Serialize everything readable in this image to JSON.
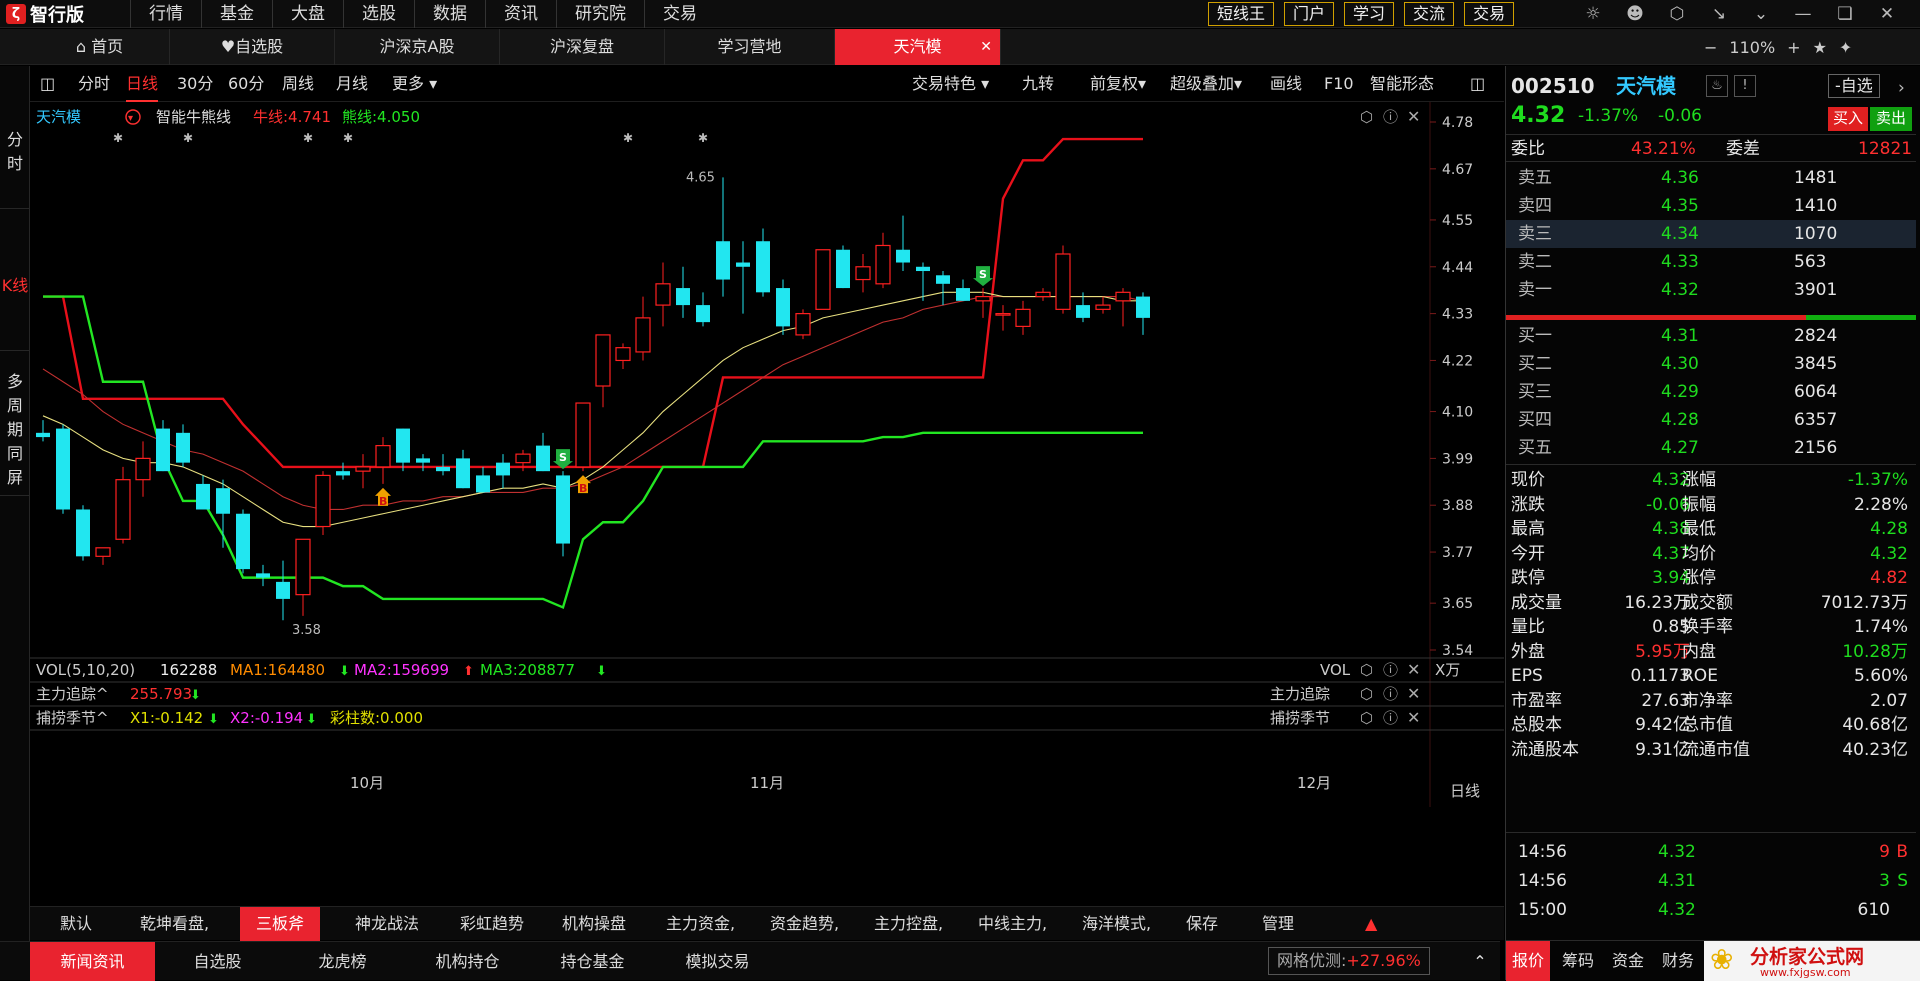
{
  "app": {
    "name": "智行版",
    "logo_glyph": "ζ"
  },
  "top_menu": [
    "行情",
    "基金",
    "大盘",
    "选股",
    "数据",
    "资讯",
    "研究院",
    "交易"
  ],
  "top_buttons": [
    "短线王",
    "门户",
    "学习",
    "交流",
    "交易"
  ],
  "top_icons": [
    "cat-icon",
    "user-icon",
    "hex-icon",
    "minimize-arrows-icon",
    "chevron-down-icon",
    "minimize-icon",
    "restore-icon",
    "close-icon"
  ],
  "tabs": [
    {
      "label": "首页",
      "icon": "home-icon"
    },
    {
      "label": "自选股",
      "icon": "heart-icon"
    },
    {
      "label": "沪深京A股"
    },
    {
      "label": "沪深复盘"
    },
    {
      "label": "学习营地"
    },
    {
      "label": "天汽模",
      "active": true
    }
  ],
  "zoom": {
    "level": "110%",
    "minus": "−",
    "plus": "+"
  },
  "left_tabs": [
    "分时",
    "K线",
    "多周期同屏"
  ],
  "chart_toolbar": {
    "left": [
      "分时",
      "日线",
      "30分",
      "60分",
      "周线",
      "月线",
      "更多"
    ],
    "active": "日线",
    "right": [
      "交易特色",
      "九转",
      "前复权",
      "超级叠加",
      "画线",
      "F10",
      "智能形态"
    ]
  },
  "chart_header": {
    "name": "天汽模",
    "indicator": "智能牛熊线",
    "bull_label": "牛线:4.741",
    "bear_label": "熊线:4.050",
    "high_mark": "4.65",
    "low_mark": "3.58"
  },
  "vol_header": {
    "label": "VOL(5,10,20)",
    "value": "162288",
    "ma1": "MA1:164480",
    "ma2": "MA2:159699",
    "ma3": "MA3:208877",
    "right_label": "VOL",
    "unit": "X万"
  },
  "sub1": {
    "label": "主力追踪^",
    "value": "255.793",
    "right_label": "主力追踪"
  },
  "sub2": {
    "label": "捕捞季节^",
    "x1": "X1:-0.142",
    "x2": "X2:-0.194",
    "bars": "彩柱数:0.000",
    "right_label": "捕捞季节"
  },
  "x_axis": {
    "labels": [
      "10月",
      "11月",
      "12月"
    ],
    "period": "日线"
  },
  "indicator_tabs": [
    "默认",
    "乾坤看盘,",
    "三板斧",
    "神龙战法",
    "彩虹趋势",
    "机构操盘",
    "主力资金,",
    "资金趋势,",
    "主力控盘,",
    "中线主力,",
    "海洋模式,",
    "保存",
    "管理"
  ],
  "indicator_active": "三板斧",
  "bottom_tabs": [
    "新闻资讯",
    "自选股",
    "龙虎榜",
    "机构持仓",
    "持仓基金",
    "模拟交易"
  ],
  "bottom_active": "新闻资讯",
  "optimize": {
    "label": "网格优测:",
    "value": "+27.96%"
  },
  "quote": {
    "code": "002510",
    "name": "天汽模",
    "price": "4.32",
    "change_pct": "-1.37%",
    "change": "-0.06",
    "add_watch": "-自选",
    "buy": "买入",
    "sell": "卖出",
    "weibi_label": "委比",
    "weibi": "43.21%",
    "weicha_label": "委差",
    "weicha": "12821",
    "asks": [
      {
        "label": "卖五",
        "price": "4.36",
        "vol": "1481"
      },
      {
        "label": "卖四",
        "price": "4.35",
        "vol": "1410"
      },
      {
        "label": "卖三",
        "price": "4.34",
        "vol": "1070"
      },
      {
        "label": "卖二",
        "price": "4.33",
        "vol": "563"
      },
      {
        "label": "卖一",
        "price": "4.32",
        "vol": "3901"
      }
    ],
    "bids": [
      {
        "label": "买一",
        "price": "4.31",
        "vol": "2824"
      },
      {
        "label": "买二",
        "price": "4.30",
        "vol": "3845"
      },
      {
        "label": "买三",
        "price": "4.29",
        "vol": "6064"
      },
      {
        "label": "买四",
        "price": "4.28",
        "vol": "6357"
      },
      {
        "label": "买五",
        "price": "4.27",
        "vol": "2156"
      }
    ],
    "stats": [
      [
        "现价",
        "4.32",
        "涨幅",
        "-1.37%"
      ],
      [
        "涨跌",
        "-0.06",
        "振幅",
        "2.28%"
      ],
      [
        "最高",
        "4.38",
        "最低",
        "4.28"
      ],
      [
        "今开",
        "4.37",
        "均价",
        "4.32"
      ],
      [
        "跌停",
        "3.94",
        "涨停",
        "4.82"
      ],
      [
        "成交量",
        "16.23万",
        "成交额",
        "7012.73万"
      ],
      [
        "量比",
        "0.85",
        "换手率",
        "1.74%"
      ],
      [
        "外盘",
        "5.95万",
        "内盘",
        "10.28万"
      ],
      [
        "EPS",
        "0.1173",
        "ROE",
        "5.60%"
      ],
      [
        "市盈率",
        "27.63",
        "市净率",
        "2.07"
      ],
      [
        "总股本",
        "9.42亿",
        "总市值",
        "40.68亿"
      ],
      [
        "流通股本",
        "9.31亿",
        "流通市值",
        "40.23亿"
      ]
    ],
    "ticks": [
      {
        "time": "14:56",
        "price": "4.32",
        "vol": "9",
        "side": "B"
      },
      {
        "time": "14:56",
        "price": "4.31",
        "vol": "3",
        "side": "S"
      },
      {
        "time": "15:00",
        "price": "4.32",
        "vol": "610",
        "side": ""
      }
    ],
    "bottom_tabs": [
      "报价",
      "筹码",
      "资金",
      "财务"
    ],
    "watermark": {
      "cn": "分析家公式网",
      "url": "www.fxjgsw.com"
    }
  },
  "colors": {
    "up": "#ff2020",
    "down": "#22e6f0",
    "bull": "#e8101a",
    "bear": "#22e622",
    "ma_yellow": "#e8e080",
    "ma_red": "#c03030"
  },
  "chart_data": {
    "type": "candlestick",
    "y_ticks": [
      "4.78",
      "4.67",
      "4.55",
      "4.44",
      "4.33",
      "4.22",
      "4.10",
      "3.99",
      "3.88",
      "3.77",
      "3.65",
      "3.54"
    ],
    "ylim": [
      3.54,
      4.78
    ],
    "candles": [
      {
        "o": 4.05,
        "h": 4.08,
        "l": 4.03,
        "c": 4.04
      },
      {
        "o": 4.06,
        "h": 4.07,
        "l": 3.86,
        "c": 3.87
      },
      {
        "o": 3.87,
        "h": 3.88,
        "l": 3.75,
        "c": 3.76
      },
      {
        "o": 3.76,
        "h": 3.78,
        "l": 3.74,
        "c": 3.78
      },
      {
        "o": 3.8,
        "h": 3.97,
        "l": 3.79,
        "c": 3.94
      },
      {
        "o": 3.94,
        "h": 4.03,
        "l": 3.9,
        "c": 3.99
      },
      {
        "o": 4.06,
        "h": 4.08,
        "l": 3.96,
        "c": 3.96
      },
      {
        "o": 4.05,
        "h": 4.07,
        "l": 3.97,
        "c": 3.98
      },
      {
        "o": 3.93,
        "h": 3.95,
        "l": 3.87,
        "c": 3.87
      },
      {
        "o": 3.92,
        "h": 3.94,
        "l": 3.78,
        "c": 3.86
      },
      {
        "o": 3.86,
        "h": 3.87,
        "l": 3.72,
        "c": 3.73
      },
      {
        "o": 3.72,
        "h": 3.74,
        "l": 3.69,
        "c": 3.71
      },
      {
        "o": 3.7,
        "h": 3.75,
        "l": 3.61,
        "c": 3.66
      },
      {
        "o": 3.67,
        "h": 3.77,
        "l": 3.62,
        "c": 3.8
      },
      {
        "o": 3.83,
        "h": 3.96,
        "l": 3.81,
        "c": 3.95
      },
      {
        "o": 3.96,
        "h": 3.98,
        "l": 3.94,
        "c": 3.95
      },
      {
        "o": 3.96,
        "h": 4.0,
        "l": 3.92,
        "c": 3.97
      },
      {
        "o": 3.97,
        "h": 4.04,
        "l": 3.93,
        "c": 4.02
      },
      {
        "o": 4.06,
        "h": 4.06,
        "l": 3.96,
        "c": 3.98
      },
      {
        "o": 3.99,
        "h": 4.0,
        "l": 3.96,
        "c": 3.98
      },
      {
        "o": 3.97,
        "h": 4.0,
        "l": 3.95,
        "c": 3.96
      },
      {
        "o": 3.99,
        "h": 4.01,
        "l": 3.92,
        "c": 3.92
      },
      {
        "o": 3.95,
        "h": 3.97,
        "l": 3.91,
        "c": 3.91
      },
      {
        "o": 3.98,
        "h": 4.0,
        "l": 3.92,
        "c": 3.95
      },
      {
        "o": 3.98,
        "h": 4.01,
        "l": 3.96,
        "c": 4.0
      },
      {
        "o": 4.02,
        "h": 4.05,
        "l": 3.96,
        "c": 3.96
      },
      {
        "o": 3.95,
        "h": 3.96,
        "l": 3.76,
        "c": 3.79
      },
      {
        "o": 3.97,
        "h": 4.12,
        "l": 3.96,
        "c": 4.12
      },
      {
        "o": 4.16,
        "h": 4.28,
        "l": 4.11,
        "c": 4.28
      },
      {
        "o": 4.22,
        "h": 4.26,
        "l": 4.2,
        "c": 4.25
      },
      {
        "o": 4.24,
        "h": 4.37,
        "l": 4.22,
        "c": 4.32
      },
      {
        "o": 4.35,
        "h": 4.45,
        "l": 4.3,
        "c": 4.4
      },
      {
        "o": 4.39,
        "h": 4.44,
        "l": 4.32,
        "c": 4.35
      },
      {
        "o": 4.35,
        "h": 4.38,
        "l": 4.3,
        "c": 4.31
      },
      {
        "o": 4.5,
        "h": 4.65,
        "l": 4.37,
        "c": 4.41
      },
      {
        "o": 4.45,
        "h": 4.5,
        "l": 4.33,
        "c": 4.44
      },
      {
        "o": 4.5,
        "h": 4.53,
        "l": 4.37,
        "c": 4.38
      },
      {
        "o": 4.39,
        "h": 4.41,
        "l": 4.28,
        "c": 4.3
      },
      {
        "o": 4.28,
        "h": 4.34,
        "l": 4.27,
        "c": 4.33
      },
      {
        "o": 4.34,
        "h": 4.48,
        "l": 4.34,
        "c": 4.48
      },
      {
        "o": 4.48,
        "h": 4.49,
        "l": 4.39,
        "c": 4.39
      },
      {
        "o": 4.41,
        "h": 4.47,
        "l": 4.38,
        "c": 4.44
      },
      {
        "o": 4.4,
        "h": 4.52,
        "l": 4.39,
        "c": 4.49
      },
      {
        "o": 4.48,
        "h": 4.56,
        "l": 4.43,
        "c": 4.45
      },
      {
        "o": 4.44,
        "h": 4.45,
        "l": 4.36,
        "c": 4.43
      },
      {
        "o": 4.42,
        "h": 4.43,
        "l": 4.35,
        "c": 4.4
      },
      {
        "o": 4.39,
        "h": 4.41,
        "l": 4.36,
        "c": 4.36
      },
      {
        "o": 4.36,
        "h": 4.39,
        "l": 4.32,
        "c": 4.37
      },
      {
        "o": 4.33,
        "h": 4.35,
        "l": 4.29,
        "c": 4.33
      },
      {
        "o": 4.3,
        "h": 4.36,
        "l": 4.28,
        "c": 4.34
      },
      {
        "o": 4.37,
        "h": 4.39,
        "l": 4.36,
        "c": 4.38
      },
      {
        "o": 4.34,
        "h": 4.49,
        "l": 4.33,
        "c": 4.47
      },
      {
        "o": 4.35,
        "h": 4.38,
        "l": 4.31,
        "c": 4.32
      },
      {
        "o": 4.34,
        "h": 4.37,
        "l": 4.33,
        "c": 4.35
      },
      {
        "o": 4.36,
        "h": 4.39,
        "l": 4.3,
        "c": 4.38
      },
      {
        "o": 4.37,
        "h": 4.38,
        "l": 4.28,
        "c": 4.32
      }
    ],
    "bull_line": [
      4.37,
      4.37,
      4.13,
      4.13,
      4.13,
      4.13,
      4.13,
      4.13,
      4.13,
      4.13,
      4.07,
      4.02,
      3.97,
      3.97,
      3.97,
      3.97,
      3.97,
      3.97,
      3.97,
      3.97,
      3.97,
      3.97,
      3.97,
      3.97,
      3.97,
      3.97,
      3.97,
      3.97,
      3.97,
      3.97,
      3.97,
      3.97,
      3.97,
      3.97,
      4.18,
      4.18,
      4.18,
      4.18,
      4.18,
      4.18,
      4.18,
      4.18,
      4.18,
      4.18,
      4.18,
      4.18,
      4.18,
      4.18,
      4.6,
      4.69,
      4.69,
      4.74,
      4.74,
      4.74,
      4.74,
      4.74
    ],
    "bear_line": [
      4.37,
      4.37,
      4.37,
      4.17,
      4.17,
      4.17,
      3.99,
      3.89,
      3.89,
      3.81,
      3.71,
      3.71,
      3.71,
      3.71,
      3.71,
      3.69,
      3.69,
      3.66,
      3.66,
      3.66,
      3.66,
      3.66,
      3.66,
      3.66,
      3.66,
      3.66,
      3.64,
      3.8,
      3.84,
      3.84,
      3.89,
      3.97,
      3.97,
      3.97,
      3.97,
      3.97,
      4.03,
      4.03,
      4.03,
      4.03,
      4.03,
      4.03,
      4.04,
      4.04,
      4.05,
      4.05,
      4.05,
      4.05,
      4.05,
      4.05,
      4.05,
      4.05,
      4.05,
      4.05,
      4.05,
      4.05
    ],
    "ma_yellow": [
      4.09,
      4.07,
      4.04,
      4.01,
      3.99,
      3.98,
      3.98,
      3.97,
      3.95,
      3.93,
      3.9,
      3.87,
      3.84,
      3.83,
      3.83,
      3.84,
      3.85,
      3.86,
      3.87,
      3.88,
      3.89,
      3.9,
      3.91,
      3.92,
      3.92,
      3.93,
      3.92,
      3.94,
      3.97,
      4.01,
      4.05,
      4.1,
      4.14,
      4.18,
      4.22,
      4.25,
      4.27,
      4.29,
      4.3,
      4.32,
      4.33,
      4.34,
      4.35,
      4.36,
      4.37,
      4.38,
      4.38,
      4.38,
      4.37,
      4.37,
      4.37,
      4.37,
      4.37,
      4.37,
      4.36,
      4.36
    ],
    "ma_red": [
      4.2,
      4.17,
      4.14,
      4.1,
      4.07,
      4.05,
      4.03,
      4.01,
      4.0,
      3.98,
      3.96,
      3.93,
      3.9,
      3.88,
      3.87,
      3.87,
      3.88,
      3.88,
      3.89,
      3.89,
      3.9,
      3.9,
      3.91,
      3.91,
      3.91,
      3.92,
      3.92,
      3.93,
      3.95,
      3.97,
      4.0,
      4.03,
      4.06,
      4.09,
      4.12,
      4.15,
      4.18,
      4.21,
      4.23,
      4.25,
      4.27,
      4.29,
      4.31,
      4.32,
      4.34,
      4.35,
      4.36,
      4.37,
      4.37,
      4.37,
      4.37,
      4.37,
      4.37,
      4.37,
      4.37,
      4.36
    ],
    "signals": [
      {
        "index": 17,
        "type": "B"
      },
      {
        "index": 26,
        "type": "S"
      },
      {
        "index": 27,
        "type": "B"
      },
      {
        "index": 47,
        "type": "S"
      }
    ]
  }
}
